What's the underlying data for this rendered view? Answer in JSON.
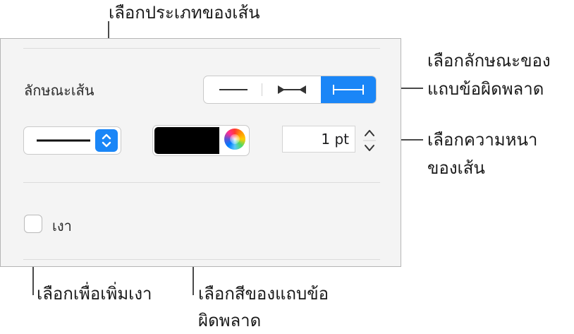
{
  "callouts": {
    "line_type": "เลือกประเภทของเส้น",
    "endpoint_line1": "เลือกลักษณะของ",
    "endpoint_line2": "แถบข้อผิดพลาด",
    "thickness_line1": "เลือกความหนา",
    "thickness_line2": "ของเส้น",
    "shadow": "เลือกเพื่อเพิ่มเงา",
    "color_line1": "เลือกสีของแถบข้อ",
    "color_line2": "ผิดพลาด"
  },
  "inspector": {
    "line_style_label": "ลักษณะเส้น",
    "endpoint_segments": [
      {
        "icon": "plain-line-icon",
        "selected": false
      },
      {
        "icon": "arrow-ends-line-icon",
        "selected": false
      },
      {
        "icon": "bar-ends-line-icon",
        "selected": true
      }
    ],
    "line_style_value": "solid-line",
    "stroke_color": "#000000",
    "thickness": "1 pt",
    "shadow_label": "เงา",
    "shadow_checked": false
  },
  "colors": {
    "accent": "#1a86f7",
    "panel_bg": "#f4f4f4",
    "callout_line": "#4a4a4a"
  }
}
